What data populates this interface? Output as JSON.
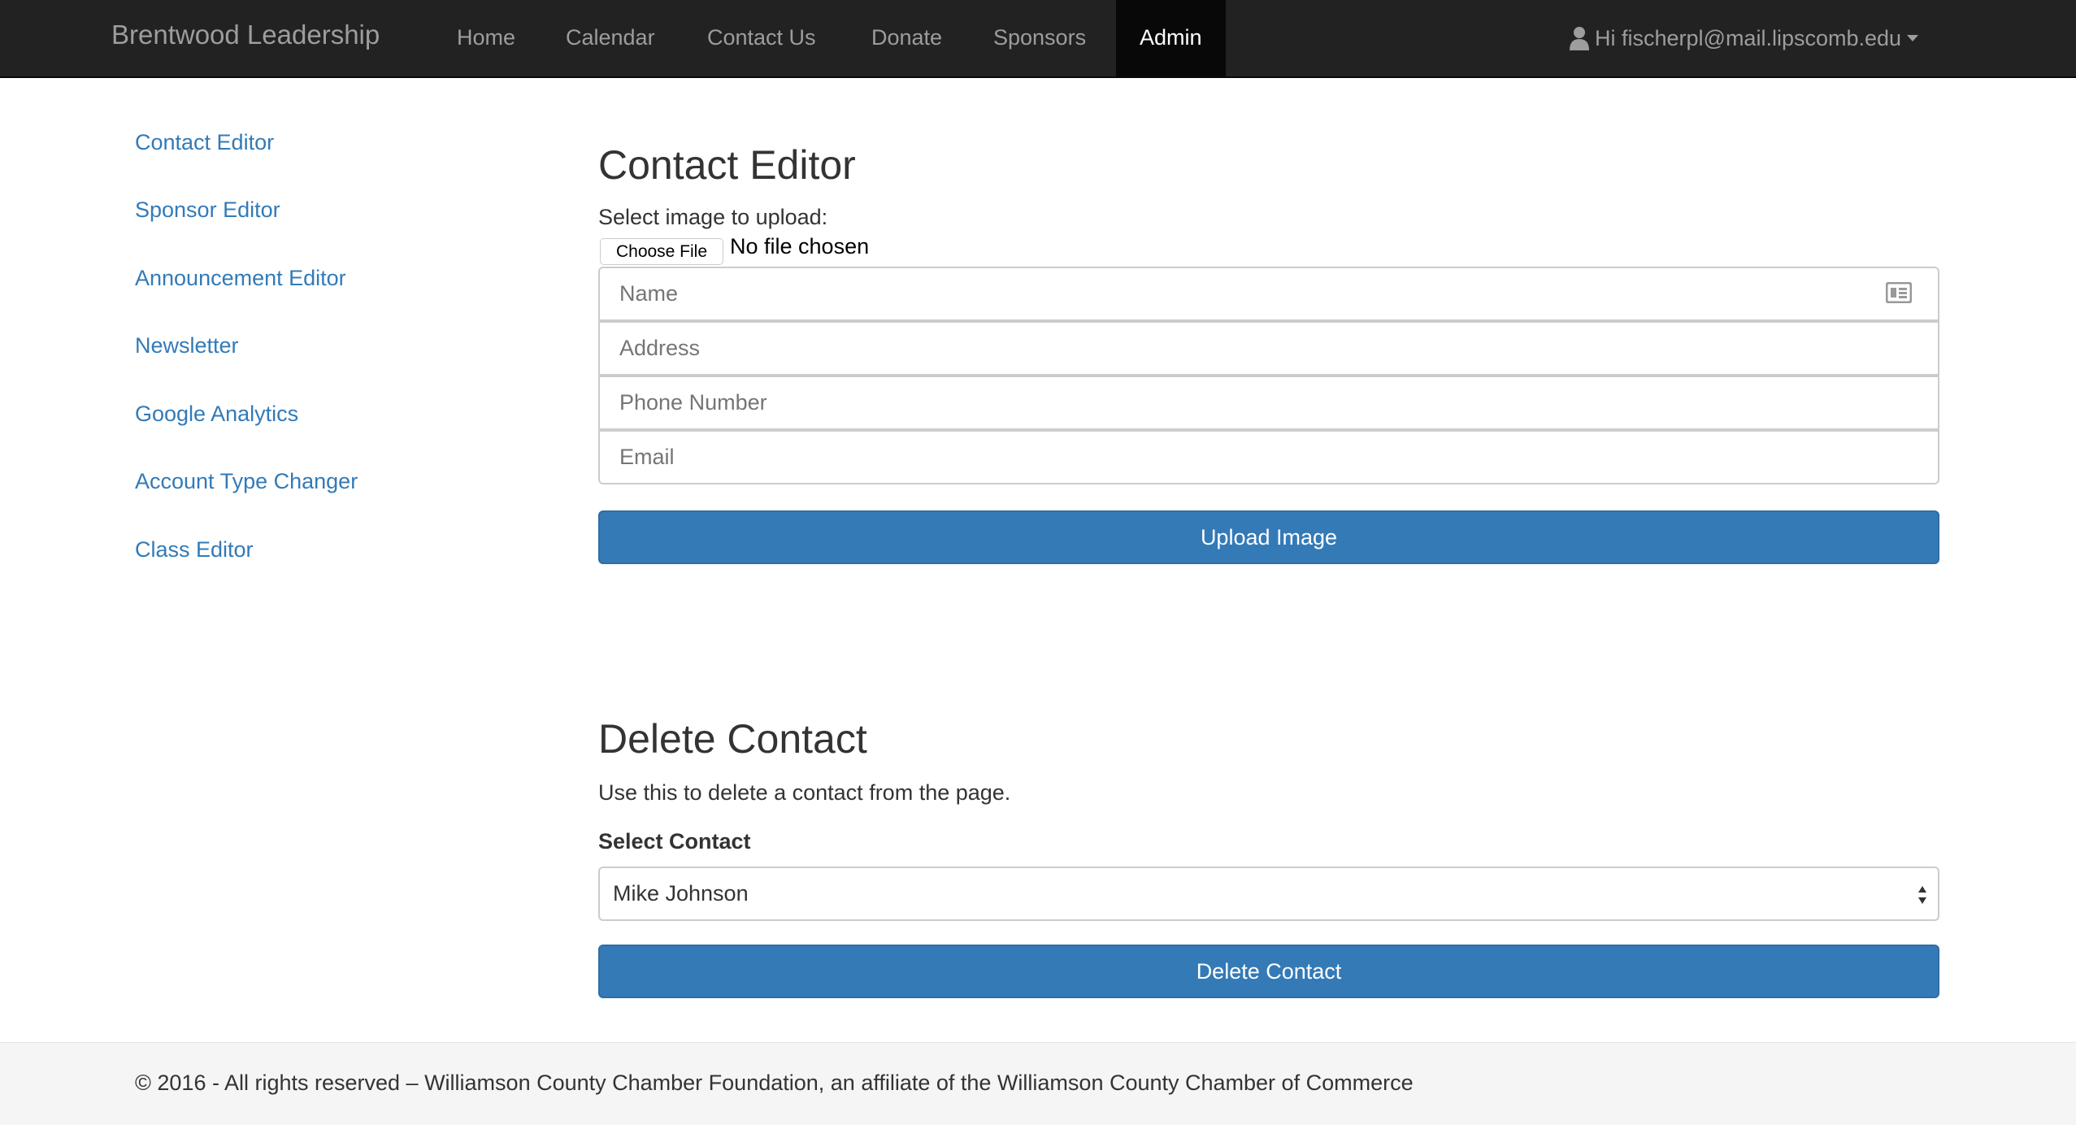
{
  "navbar": {
    "brand": "Brentwood Leadership",
    "items": [
      "Home",
      "Calendar",
      "Contact Us",
      "Donate",
      "Sponsors",
      "Admin"
    ],
    "active": "Admin",
    "user": "Hi fischerpl@mail.lipscomb.edu"
  },
  "sidebar": {
    "items": [
      "Contact Editor",
      "Sponsor Editor",
      "Announcement Editor",
      "Newsletter",
      "Google Analytics",
      "Account Type Changer",
      "Class Editor"
    ]
  },
  "contact_editor": {
    "title": "Contact Editor",
    "upload_label": "Select image to upload:",
    "choose_file": "Choose File",
    "no_file": "No file chosen",
    "name_placeholder": "Name",
    "address_placeholder": "Address",
    "phone_placeholder": "Phone Number",
    "email_placeholder": "Email",
    "upload_button": "Upload Image"
  },
  "delete_contact": {
    "title": "Delete Contact",
    "description": "Use this to delete a contact from the page.",
    "select_label": "Select Contact",
    "selected": "Mike Johnson",
    "delete_button": "Delete Contact"
  },
  "footer": {
    "text": "© 2016 - All rights reserved – Williamson County Chamber Foundation, an affiliate of the Williamson County Chamber of Commerce"
  }
}
